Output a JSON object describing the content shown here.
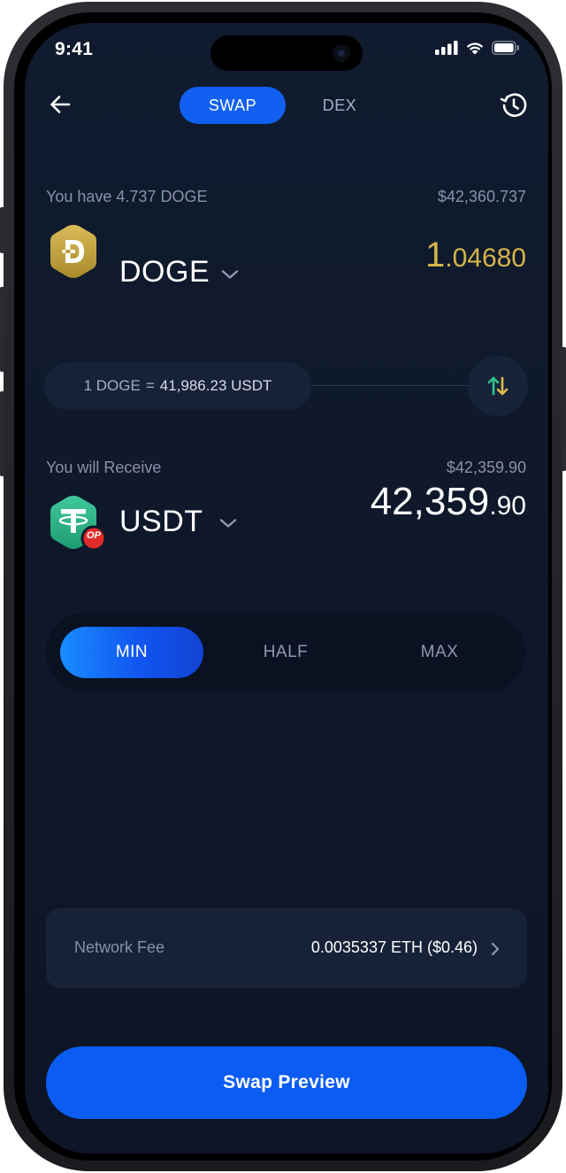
{
  "status_bar": {
    "time": "9:41"
  },
  "header": {
    "tabs": [
      "SWAP",
      "DEX"
    ],
    "active_tab": "SWAP"
  },
  "from": {
    "balance_label": "You have 4.737 DOGE",
    "fiat_value": "$42,360.737",
    "coin": "DOGE",
    "amount_int": "1",
    "amount_dec": ".04680",
    "icon": "doge-coin-icon"
  },
  "rate": {
    "left": "1 DOGE",
    "eq": "=",
    "right": "41,986.23 USDT"
  },
  "to": {
    "label": "You will Receive",
    "fiat_value": "$42,359.90",
    "coin": "USDT",
    "amount_int": "42,359",
    "amount_dec": ".90",
    "icon": "tether-coin-icon",
    "network_badge": "OP"
  },
  "amount_presets": {
    "options": [
      "MIN",
      "HALF",
      "MAX"
    ],
    "selected": "MIN"
  },
  "network_fee": {
    "label": "Network Fee",
    "value": "0.0035337 ETH ($0.46)"
  },
  "cta": {
    "label": "Swap Preview"
  },
  "colors": {
    "accent": "#1160f2",
    "doge_amount": "#d4b54a",
    "background": "#111b2f"
  }
}
